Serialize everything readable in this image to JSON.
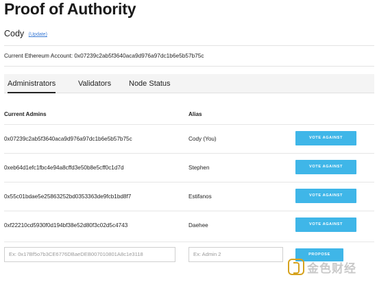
{
  "header": {
    "title": "Proof of Authority",
    "user_name": "Cody",
    "update_link": "(Update)",
    "account_label": "Current Ethereum Account:",
    "account_address": "0x07239c2ab5f3640aca9d976a97dc1b6e5b57b75c"
  },
  "tabs": [
    {
      "label": "Administrators",
      "active": true
    },
    {
      "label": "Validators",
      "active": false
    },
    {
      "label": "Node Status",
      "active": false
    }
  ],
  "table": {
    "headers": {
      "admins": "Current Admins",
      "alias": "Alias"
    },
    "rows": [
      {
        "address": "0x07239c2ab5f3640aca9d976a97dc1b6e5b57b75c",
        "alias": "Cody (You)",
        "action": "VOTE AGAINST"
      },
      {
        "address": "0xeb64d1efc1fbc4e94a8cffd3e50b8e5cff0c1d7d",
        "alias": "Stephen",
        "action": "VOTE AGAINST"
      },
      {
        "address": "0x55c01bdae5e25863252bd0353363de9fcb1bd8f7",
        "alias": "Estifanos",
        "action": "VOTE AGAINST"
      },
      {
        "address": "0xf22210cd5930f0d194bf38e52d80f3c02d5c4743",
        "alias": "Daehee",
        "action": "VOTE AGAINST"
      }
    ]
  },
  "propose": {
    "address_placeholder": "Ex: 0x17Bf5o7b3CE6776DBaeDEB007010801A8c1e3118",
    "alias_placeholder": "Ex: Admin 2",
    "button_label": "PROPOSE"
  },
  "watermark": {
    "text": "金色财经"
  },
  "colors": {
    "accent": "#3fb6e8",
    "link": "#3a7bd5"
  }
}
